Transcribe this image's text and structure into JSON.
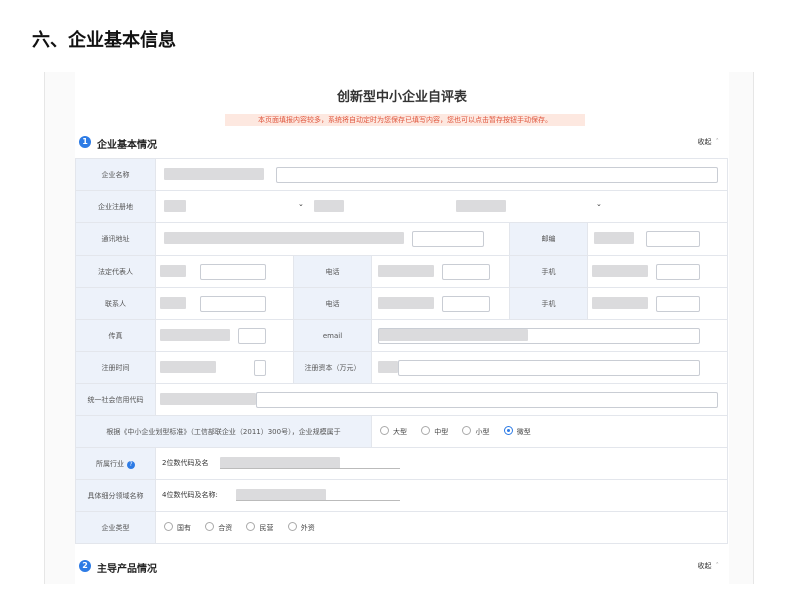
{
  "page_heading": "六、企业基本信息",
  "form": {
    "title": "创新型中小企业自评表",
    "notice": "本页面填报内容较多，系统将自动定时为您保存已填写内容，您也可以点击暂存按钮手动保存。"
  },
  "sections": [
    {
      "number": "1",
      "title": "企业基本情况",
      "toggle_label": "收起",
      "toggle_icon": "chevron-up-icon"
    },
    {
      "number": "2",
      "title": "主导产品情况",
      "toggle_label": "收起",
      "toggle_icon": "chevron-up-icon"
    }
  ],
  "fields": {
    "company_name": {
      "label": "企业名称"
    },
    "reg_location": {
      "label": "企业注册地",
      "arrow": "⌄"
    },
    "address": {
      "label": "通讯地址"
    },
    "postcode": {
      "label": "邮编"
    },
    "legal_rep": {
      "label": "法定代表人"
    },
    "legal_phone": {
      "label": "电话"
    },
    "legal_mobile": {
      "label": "手机"
    },
    "contact": {
      "label": "联系人"
    },
    "contact_phone": {
      "label": "电话"
    },
    "contact_mobile": {
      "label": "手机"
    },
    "fax": {
      "label": "传真"
    },
    "email": {
      "label": "email"
    },
    "reg_date": {
      "label": "注册时间"
    },
    "reg_capital": {
      "label": "注册资本（万元）"
    },
    "credit_code": {
      "label": "统一社会信用代码"
    },
    "scale": {
      "label": "根据《中小企业划型标准》（工信部联企业（2011）300号），企业规模属于",
      "options": [
        "大型",
        "中型",
        "小型",
        "微型"
      ],
      "selected": "微型"
    },
    "industry": {
      "label": "所属行业",
      "value_prefix": "2位数代码及名"
    },
    "niche": {
      "label": "具体细分领域名称",
      "value_prefix": "4位数代码及名称:"
    },
    "company_type": {
      "label": "企业类型",
      "options": [
        "国有",
        "合资",
        "民营",
        "外资"
      ],
      "selected": ""
    }
  }
}
